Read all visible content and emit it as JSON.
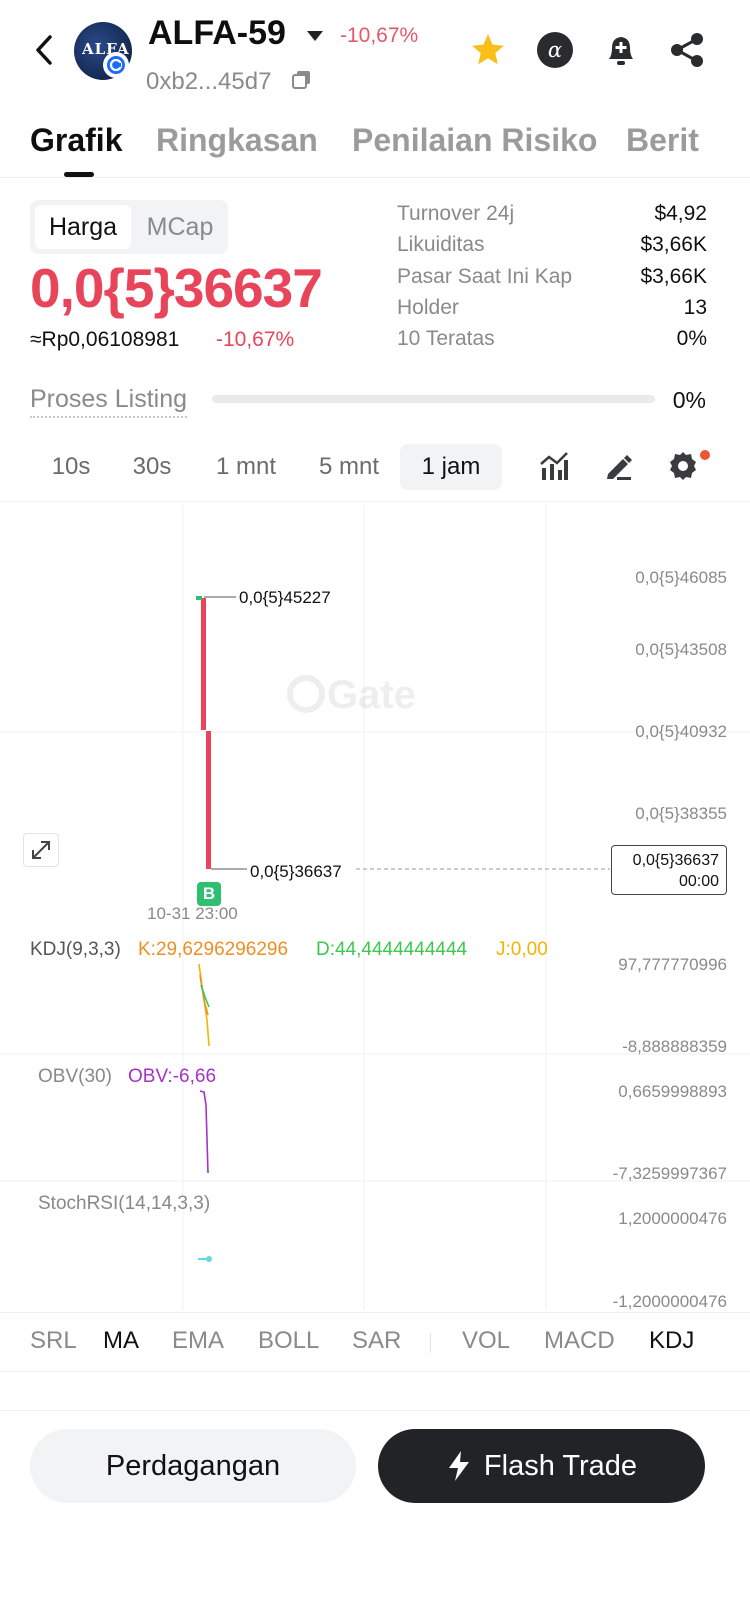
{
  "header": {
    "logo_text": "ALFA",
    "token_name": "ALFA-59",
    "change": "-10,67%",
    "address": "0xb2...45d7",
    "icons": [
      "star-icon",
      "alpha-icon",
      "bell-plus-icon",
      "share-icon"
    ]
  },
  "tabs": [
    "Grafik",
    "Ringkasan",
    "Penilaian Risiko",
    "Berit"
  ],
  "price_toggle": {
    "active": "Harga",
    "inactive": "MCap"
  },
  "price": {
    "main": "0,0{5}36637",
    "idr": "≈Rp0,06108981",
    "change": "-10,67%"
  },
  "stats": [
    {
      "label": "Turnover 24j",
      "value": "$4,92"
    },
    {
      "label": "Likuiditas",
      "value": "$3,66K"
    },
    {
      "label": "Pasar Saat Ini Kap",
      "value": "$3,66K"
    },
    {
      "label": "Holder",
      "value": "13"
    },
    {
      "label": "10 Teratas",
      "value": "0%"
    }
  ],
  "listing": {
    "label": "Proses Listing",
    "progress": 0,
    "value": "0%"
  },
  "intervals": {
    "items": [
      "10s",
      "30s",
      "1 mnt",
      "5 mnt",
      "1 jam"
    ],
    "active": "1 jam",
    "tools": [
      "indicator-chart-icon",
      "draw-pen-icon",
      "settings-gear-icon"
    ]
  },
  "chart": {
    "watermark": "Gate",
    "y_ticks": [
      "0,0{5}46085",
      "0,0{5}43508",
      "0,0{5}40932",
      "0,0{5}38355"
    ],
    "high_label": "0,0{5}45227",
    "low_label": "0,0{5}36637",
    "current_price": "0,0{5}36637",
    "current_time": "00:00",
    "x_label": "10-31 23:00",
    "marker": "B",
    "colors": {
      "down": "#e8445a",
      "up": "#2fbf71"
    }
  },
  "indicators": {
    "kdj": {
      "name": "KDJ(9,3,3)",
      "k": "K:29,6296296296",
      "d": "D:44,4444444444",
      "j": "J:0,00",
      "max": "97,777770996",
      "min": "-8,888888359"
    },
    "obv": {
      "name": "OBV(30)",
      "value": "OBV:-6,66",
      "max": "0,6659998893",
      "min": "-7,3259997367"
    },
    "stochrsi": {
      "name": "StochRSI(14,14,3,3)",
      "max": "1,2000000476",
      "min": "-1,2000000476"
    }
  },
  "indicator_tabs": {
    "main": [
      "SRL",
      "MA",
      "EMA",
      "BOLL",
      "SAR"
    ],
    "sub": [
      "VOL",
      "MACD",
      "KDJ"
    ],
    "active": [
      "MA",
      "KDJ"
    ]
  },
  "actions": {
    "trade": "Perdagangan",
    "flash": "Flash Trade"
  }
}
